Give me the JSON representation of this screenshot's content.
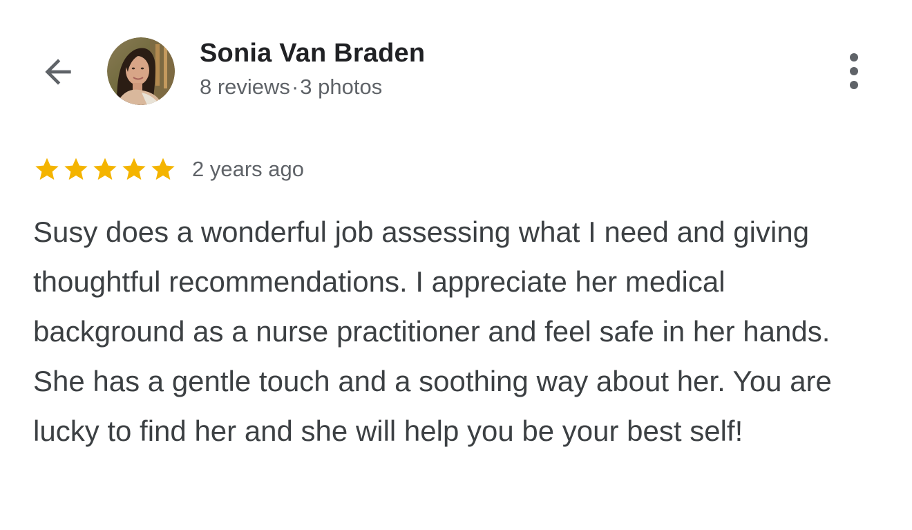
{
  "header": {
    "back_icon": "arrow-back-icon",
    "user_name": "Sonia Van Braden",
    "reviews_count": "8 reviews",
    "separator": "·",
    "photos_count": "3 photos",
    "more_icon": "more-vert-icon"
  },
  "review": {
    "rating": 5,
    "rating_max": 5,
    "star_color": "#f4b400",
    "time_ago": "2 years ago",
    "text": "Susy does a wonderful job assessing what I need and giving thoughtful recommendations. I appreciate her medical background as a nurse practitioner and feel safe in her hands. She has a gentle touch and a soothing way about her. You are lucky to find her and she will help you be your best self!"
  }
}
